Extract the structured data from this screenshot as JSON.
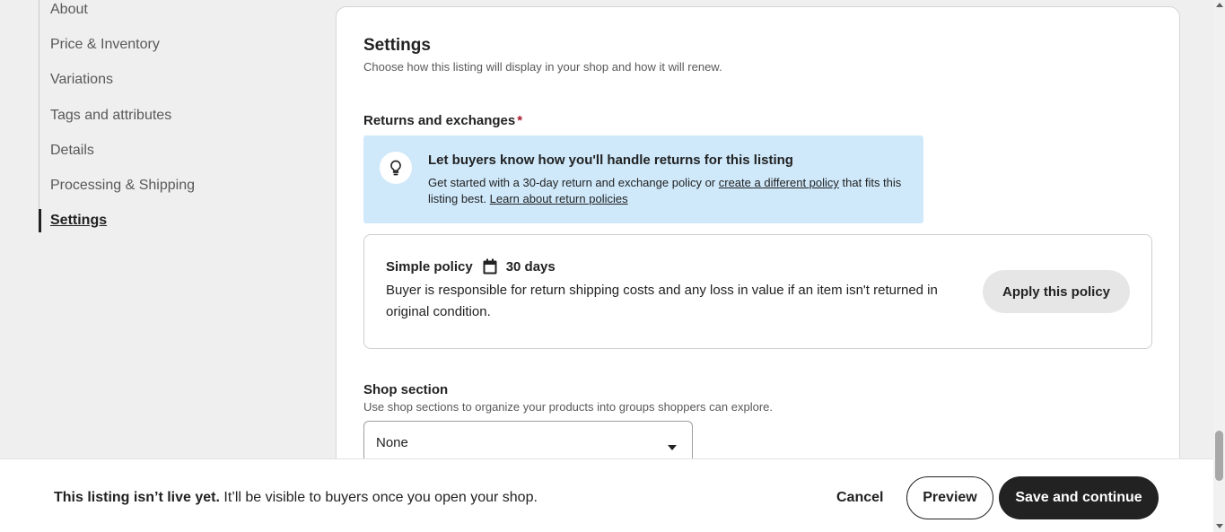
{
  "sidebar": {
    "items": [
      {
        "label": "About"
      },
      {
        "label": "Price & Inventory"
      },
      {
        "label": "Variations"
      },
      {
        "label": "Tags and attributes"
      },
      {
        "label": "Details"
      },
      {
        "label": "Processing & Shipping"
      },
      {
        "label": "Settings"
      }
    ]
  },
  "settings": {
    "title": "Settings",
    "description": "Choose how this listing will display in your shop and how it will renew."
  },
  "returns": {
    "label": "Returns and exchanges",
    "required_mark": "*",
    "info": {
      "title": "Let buyers know how you'll handle returns for this listing",
      "text_before_link": "Get started with a 30-day return and exchange policy or ",
      "link_different_policy": "create a different policy",
      "text_after_link": " that fits this listing best. ",
      "link_learn": "Learn about return policies"
    },
    "policy": {
      "name": "Simple policy",
      "duration": "30 days",
      "description": "Buyer is responsible for return shipping costs and any loss in value if an item isn't returned in original condition.",
      "apply_label": "Apply this policy"
    }
  },
  "shop_section": {
    "label": "Shop section",
    "description": "Use shop sections to organize your products into groups shoppers can explore.",
    "selected": "None"
  },
  "bottom_bar": {
    "notice_bold": "This listing isn’t live yet.",
    "notice_rest": " It’ll be visible to buyers once you open your shop.",
    "cancel_label": "Cancel",
    "preview_label": "Preview",
    "save_label": "Save and continue"
  },
  "icons": {
    "info": "lightbulb-icon",
    "policy": "calendar-icon",
    "select": "caret-down-icon"
  }
}
